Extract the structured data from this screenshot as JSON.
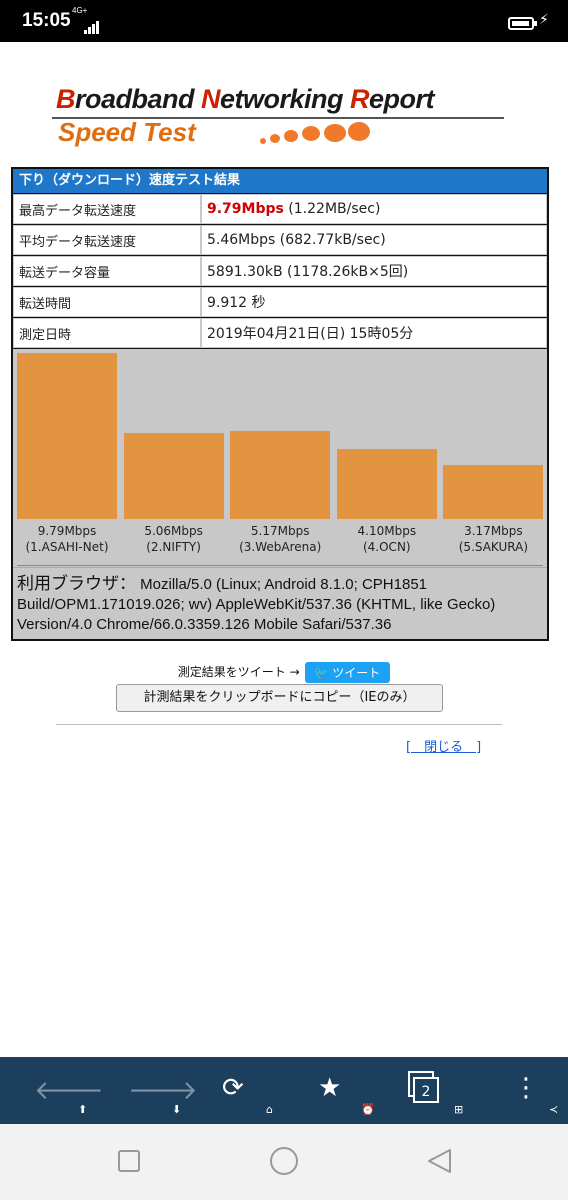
{
  "status_bar": {
    "time": "15:05",
    "network": "4G+"
  },
  "logo": {
    "title_line1_words": [
      "B",
      "roadband ",
      "N",
      "etworking ",
      "R",
      "eport"
    ],
    "title_line2": "Speed Test"
  },
  "result": {
    "header": "下り（ダウンロード）速度テスト結果",
    "rows": [
      {
        "key": "最高データ転送速度",
        "value_highlight": "9.79Mbps",
        "value": " (1.22MB/sec)"
      },
      {
        "key": "平均データ転送速度",
        "value": "5.46Mbps (682.77kB/sec)"
      },
      {
        "key": "転送データ容量",
        "value": "5891.30kB (1178.26kB×5回)"
      },
      {
        "key": "転送時間",
        "value": "9.912 秒"
      },
      {
        "key": "測定日時",
        "value": "2019年04月21日(日) 15時05分"
      }
    ],
    "browser_label": "利用ブラウザ：",
    "browser_value": " Mozilla/5.0 (Linux; Android 8.1.0; CPH1851 Build/OPM1.171019.026; wv) AppleWebKit/537.36 (KHTML, like Gecko) Version/4.0 Chrome/66.0.3359.126 Mobile Safari/537.36"
  },
  "chart_data": {
    "type": "bar",
    "categories": [
      "(1.ASAHI-Net)",
      "(2.NIFTY)",
      "(3.WebArena)",
      "(4.OCN)",
      "(5.SAKURA)"
    ],
    "value_labels": [
      "9.79Mbps",
      "5.06Mbps",
      "5.17Mbps",
      "4.10Mbps",
      "3.17Mbps"
    ],
    "values": [
      9.79,
      5.06,
      5.17,
      4.1,
      3.17
    ],
    "ylim": [
      0,
      9.79
    ],
    "color": "#e29440",
    "grid": false
  },
  "actions": {
    "tweet_prompt": "測定結果をツイート →",
    "tweet_button": "ツイート",
    "copy_button": "計測結果をクリップボードにコピー（IEのみ）",
    "close_link": "[　閉じる　]"
  },
  "toolbar": {
    "tab_count": "2"
  },
  "colors": {
    "toolbar_bg": "#1b3f5c",
    "header_bg": "#1e77c8",
    "bar": "#e29440",
    "highlight": "#d00000"
  }
}
